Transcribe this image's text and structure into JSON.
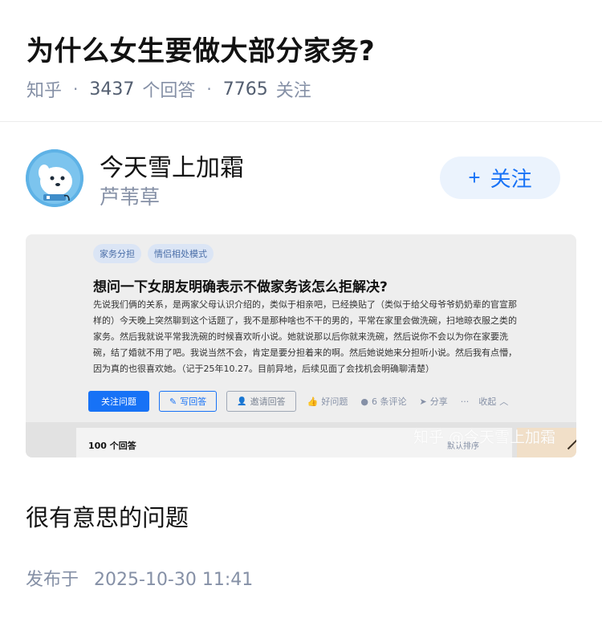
{
  "question": {
    "title": "为什么女生要做大部分家务?",
    "source": "知乎",
    "answer_count": "3437",
    "answer_label": "个回答",
    "follower_count": "7765",
    "follower_label": "关注",
    "separator": "·"
  },
  "author": {
    "name": "今天雪上加霜",
    "subtitle": "芦苇草",
    "follow_plus": "+",
    "follow_label": "关注"
  },
  "screenshot": {
    "tags": [
      "家务分担",
      "情侣相处模式"
    ],
    "title": "想问一下女朋友明确表示不做家务该怎么拒解决?",
    "body": "先说我们俩的关系，是两家父母认识介绍的，类似于相亲吧，已经换贴了（类似于给父母爷爷奶奶辈的官宣那样的）今天晚上突然聊到这个话题了，我不是那种啥也不干的男的，平常在家里会做洗碗，扫地晾衣服之类的家务。然后我就说平常我洗碗的时候喜欢听小说。她就说那以后你就来洗碗，然后说你不会以为你在家要洗碗，结了婚就不用了吧。我说当然不会，肯定是要分担着来的啊。然后她说她来分担听小说。然后我有点懵，因为真的也很喜欢她。（记于25年10.27。目前异地，后续见面了会找机会明确聊清楚）",
    "btn_follow_question": "关注问题",
    "btn_write_answer": "写回答",
    "btn_write_icon": "✎",
    "btn_invite": "邀请回答",
    "btn_invite_icon": "👤",
    "good_question": "好问题",
    "comments": "6 条评论",
    "share": "分享",
    "more": "···",
    "collapse": "收起",
    "answers_count_label": "100 个回答",
    "sort_label": "默认排序",
    "watermark": "知乎 @今天雪上加霜"
  },
  "answer": {
    "text": "很有意思的问题",
    "published_label": "发布于",
    "published_time": "2025-10-30 11:41"
  },
  "colors": {
    "accent": "#1772f6",
    "meta_grey": "#8590a6",
    "follow_bg": "#ebf3fd"
  }
}
